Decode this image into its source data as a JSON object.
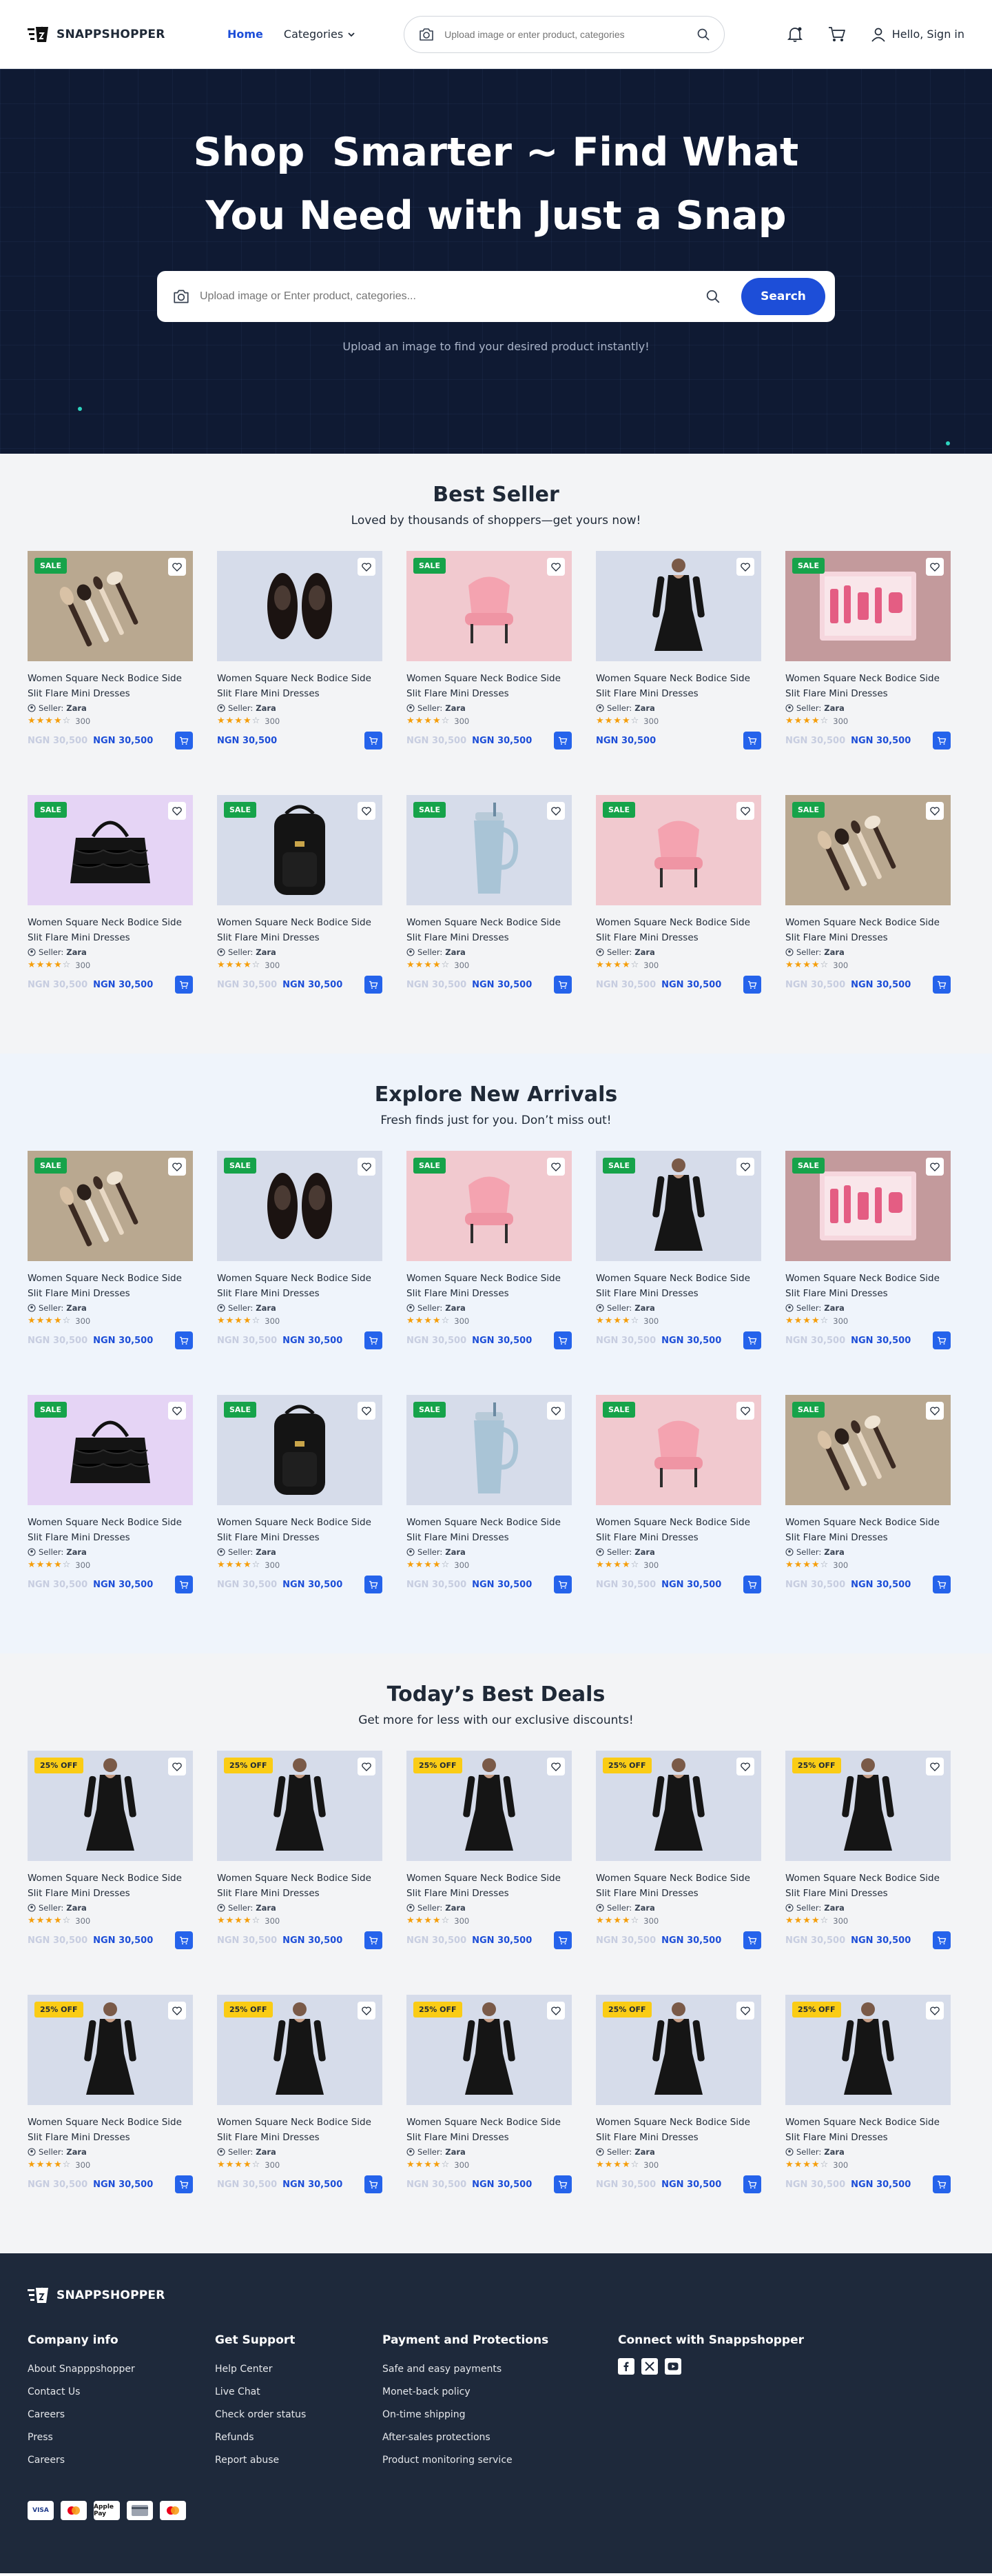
{
  "header": {
    "brand": "SNAPPSHOPPER",
    "nav_home": "Home",
    "nav_categories": "Categories",
    "search_placeholder": "Upload image or enter product, categories",
    "signin": "Hello, Sign in"
  },
  "hero": {
    "title_line1": "Shop  Smarter ~ Find What",
    "title_line2": "You Need with Just a Snap",
    "search_placeholder": "Upload image or Enter product, categories...",
    "search_button": "Search",
    "subtitle": "Upload an image to find your desired product instantly!"
  },
  "card_text": {
    "title": "Women Square Neck Bodice Side Slit Flare Mini Dresses",
    "seller_prefix": "Seller:",
    "seller": "Zara",
    "rating_count": "300",
    "old_price": "NGN 30,500",
    "new_price": "NGN 30,500",
    "rating_value": 4
  },
  "sections": [
    {
      "id": "best",
      "title": "Best Seller",
      "subtitle": "Loved by thousands of shoppers—get yours now!",
      "products": [
        {
          "image": "brushes",
          "badge": "SALE",
          "old": true
        },
        {
          "image": "shoes",
          "badge": "",
          "old": false
        },
        {
          "image": "chair",
          "badge": "SALE",
          "old": true
        },
        {
          "image": "dress",
          "badge": "",
          "old": false
        },
        {
          "image": "beauty-kit",
          "badge": "SALE",
          "old": true
        },
        {
          "image": "handbag",
          "badge": "SALE",
          "old": true
        },
        {
          "image": "backpack",
          "badge": "SALE",
          "old": true
        },
        {
          "image": "tumbler",
          "badge": "SALE",
          "old": true
        },
        {
          "image": "chair",
          "badge": "SALE",
          "old": true
        },
        {
          "image": "brushes",
          "badge": "SALE",
          "old": true
        }
      ]
    },
    {
      "id": "new",
      "title": "Explore New Arrivals",
      "subtitle": "Fresh finds just for you. Don’t miss out!",
      "products": [
        {
          "image": "brushes",
          "badge": "SALE",
          "old": true
        },
        {
          "image": "shoes",
          "badge": "SALE",
          "old": true
        },
        {
          "image": "chair",
          "badge": "SALE",
          "old": true
        },
        {
          "image": "dress",
          "badge": "SALE",
          "old": true
        },
        {
          "image": "beauty-kit",
          "badge": "SALE",
          "old": true
        },
        {
          "image": "handbag",
          "badge": "SALE",
          "old": true
        },
        {
          "image": "backpack",
          "badge": "SALE",
          "old": true
        },
        {
          "image": "tumbler",
          "badge": "SALE",
          "old": true
        },
        {
          "image": "chair",
          "badge": "SALE",
          "old": true
        },
        {
          "image": "brushes",
          "badge": "SALE",
          "old": true
        }
      ]
    },
    {
      "id": "deals",
      "title": "Today’s Best Deals",
      "subtitle": "Get more for less with our exclusive discounts!",
      "products": [
        {
          "image": "dress",
          "badge": "25% OFF",
          "old": true
        },
        {
          "image": "dress",
          "badge": "25% OFF",
          "old": true
        },
        {
          "image": "dress",
          "badge": "25% OFF",
          "old": true
        },
        {
          "image": "dress",
          "badge": "25% OFF",
          "old": true
        },
        {
          "image": "dress",
          "badge": "25% OFF",
          "old": true
        },
        {
          "image": "dress",
          "badge": "25% OFF",
          "old": true
        },
        {
          "image": "dress",
          "badge": "25% OFF",
          "old": true
        },
        {
          "image": "dress",
          "badge": "25% OFF",
          "old": true
        },
        {
          "image": "dress",
          "badge": "25% OFF",
          "old": true
        },
        {
          "image": "dress",
          "badge": "25% OFF",
          "old": true
        }
      ]
    }
  ],
  "footer": {
    "brand": "SNAPPSHOPPER",
    "columns": [
      {
        "title": "Company info",
        "links": [
          "About Snapppshopper",
          "Contact Us",
          "Careers",
          "Press",
          "Careers"
        ]
      },
      {
        "title": "Get Support",
        "links": [
          "Help Center",
          "Live Chat",
          "Check order status",
          "Refunds",
          "Report abuse"
        ]
      },
      {
        "title": "Payment and Protections",
        "links": [
          "Safe and easy payments",
          "Monet-back policy",
          "On-time shipping",
          "After-sales protections",
          "Product monitoring service"
        ]
      }
    ],
    "connect_title": "Connect with Snappshopper",
    "socials": [
      "facebook-icon",
      "x-icon",
      "youtube-icon"
    ],
    "payments": [
      "VISA",
      "mastercard",
      "Apple Pay",
      "card",
      "mastercard"
    ]
  },
  "colors": {
    "primary": "#1d4ed8",
    "hero_bg": "#0f1a33",
    "sale_badge": "#16a34a",
    "off_badge": "#facc15",
    "footer_bg": "#1e293b"
  }
}
